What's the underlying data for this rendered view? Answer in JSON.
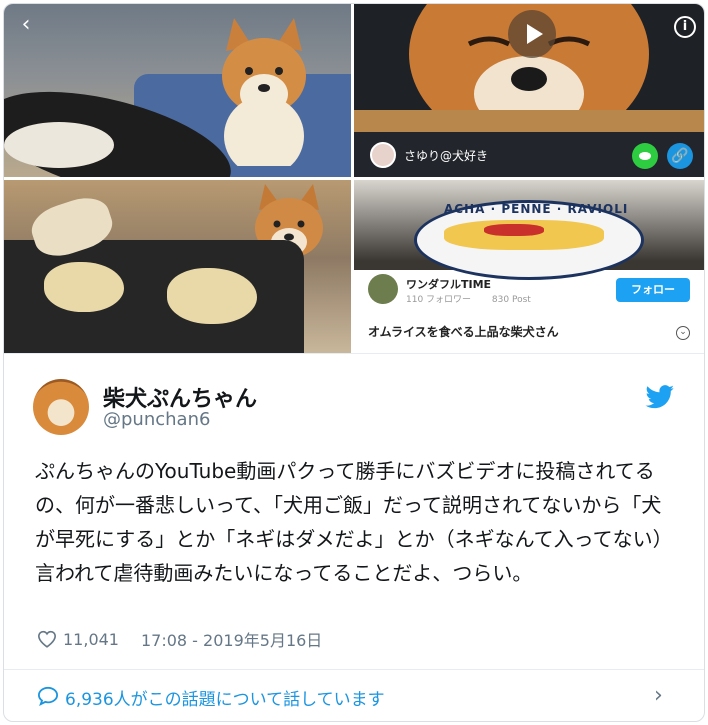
{
  "media": {
    "back_icon": "‹",
    "info_icon": "i",
    "video": {
      "user": "さゆり@犬好き",
      "play_icon": "play-icon"
    },
    "plate_text": "ACHA · PENNE · RAVIOLI",
    "card": {
      "channel_name": "ワンダフルTIME",
      "followers": "110 フォロワー",
      "posts": "830 Post",
      "follow_label": "フォロー",
      "video_title": "オムライスを食べる上品な柴犬さん"
    }
  },
  "tweet": {
    "display_name": "柴犬ぷんちゃん",
    "handle": "@punchan6",
    "text": "ぷんちゃんのYouTube動画パクって勝手にバズビデオに投稿されてるの、何が一番悲しいって、「犬用ご飯」だって説明されてないから「犬が早死にする」とか「ネギはダメだよ」とか（ネギなんて入ってない）言われて虐待動画みたいになってることだよ、つらい。",
    "likes": "11,041",
    "timestamp": "17:08 - 2019年5月16日",
    "conversation": "6,936人がこの話題について話しています"
  },
  "colors": {
    "twitter_blue": "#1da1f2",
    "link_blue": "#1b95e0",
    "muted": "#657786",
    "line_green": "#2ecc40"
  }
}
